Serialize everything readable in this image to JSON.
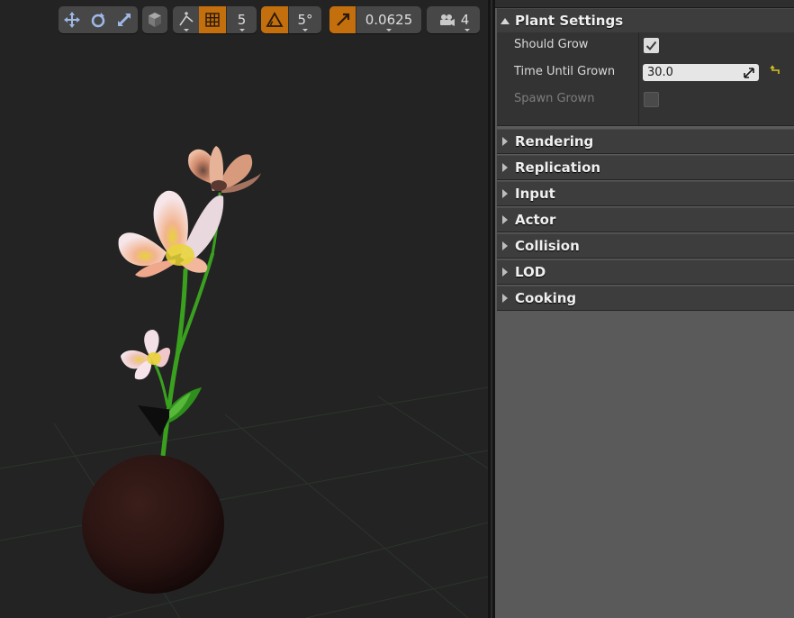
{
  "viewport_toolbar": {
    "grid_snap_value": "5",
    "rotation_snap_value": "5°",
    "scale_snap_value": "0.0625",
    "camera_speed_value": "4"
  },
  "details": {
    "section_title": "Plant Settings",
    "properties": [
      {
        "label": "Should Grow",
        "type": "checkbox",
        "checked": true
      },
      {
        "label": "Time Until Grown",
        "type": "number",
        "value": "30.0"
      },
      {
        "label": "Spawn Grown",
        "type": "checkbox",
        "checked": false,
        "disabled": true
      }
    ],
    "categories": [
      "Rendering",
      "Replication",
      "Input",
      "Actor",
      "Collision",
      "LOD",
      "Cooking"
    ]
  },
  "colors": {
    "accent": "#c46f0d",
    "viewport_bg": "#232323",
    "panel_bg": "#5a5a5a",
    "category_bg": "#3d3d3d"
  }
}
